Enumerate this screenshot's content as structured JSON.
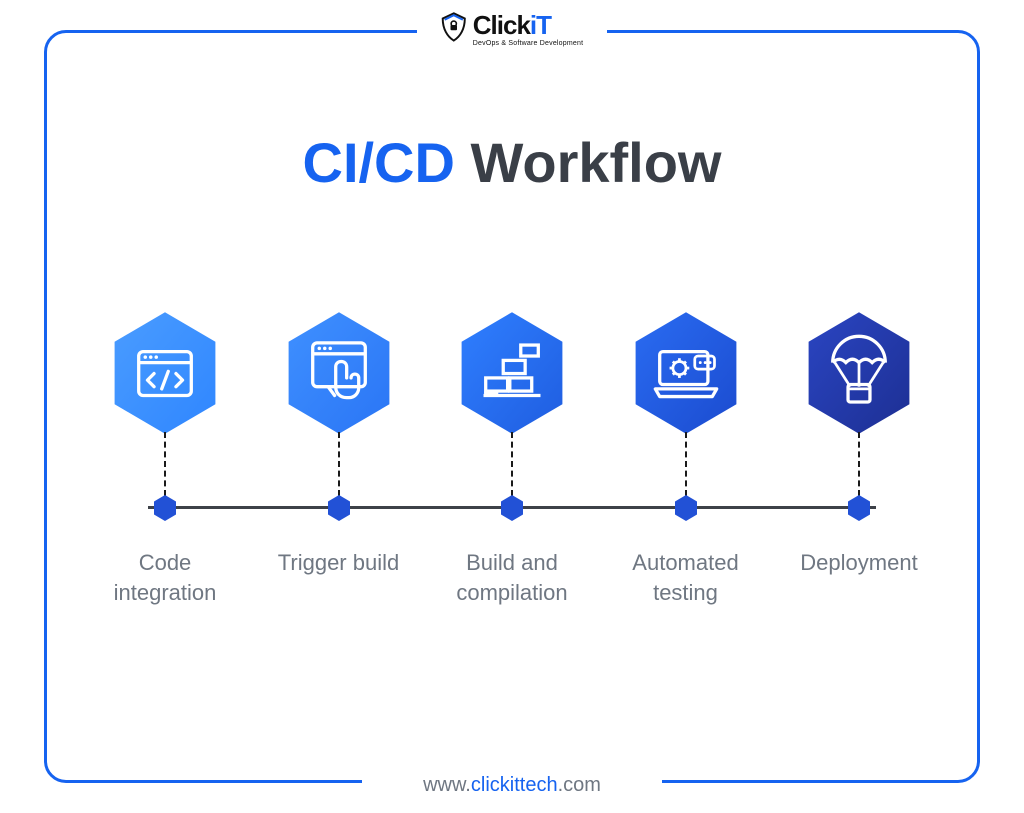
{
  "brand": {
    "name_part1": "Click",
    "name_part2": "iT",
    "tagline": "DevOps & Software Development"
  },
  "title": {
    "cicd": "CI/CD",
    "rest": " Workflow"
  },
  "steps": [
    {
      "label": "Code integration",
      "icon": "code-icon",
      "color": "#2f86ff"
    },
    {
      "label": "Trigger build",
      "icon": "touch-icon",
      "color": "#2f7cff"
    },
    {
      "label": "Build and compilation",
      "icon": "bricks-icon",
      "color": "#2563eb"
    },
    {
      "label": "Automated testing",
      "icon": "laptop-gear-icon",
      "color": "#1e4fd6"
    },
    {
      "label": "Deployment",
      "icon": "parachute-icon",
      "color": "#2236a6"
    }
  ],
  "url": {
    "prefix": "www.",
    "domain": "clickittech",
    "suffix": ".com"
  }
}
